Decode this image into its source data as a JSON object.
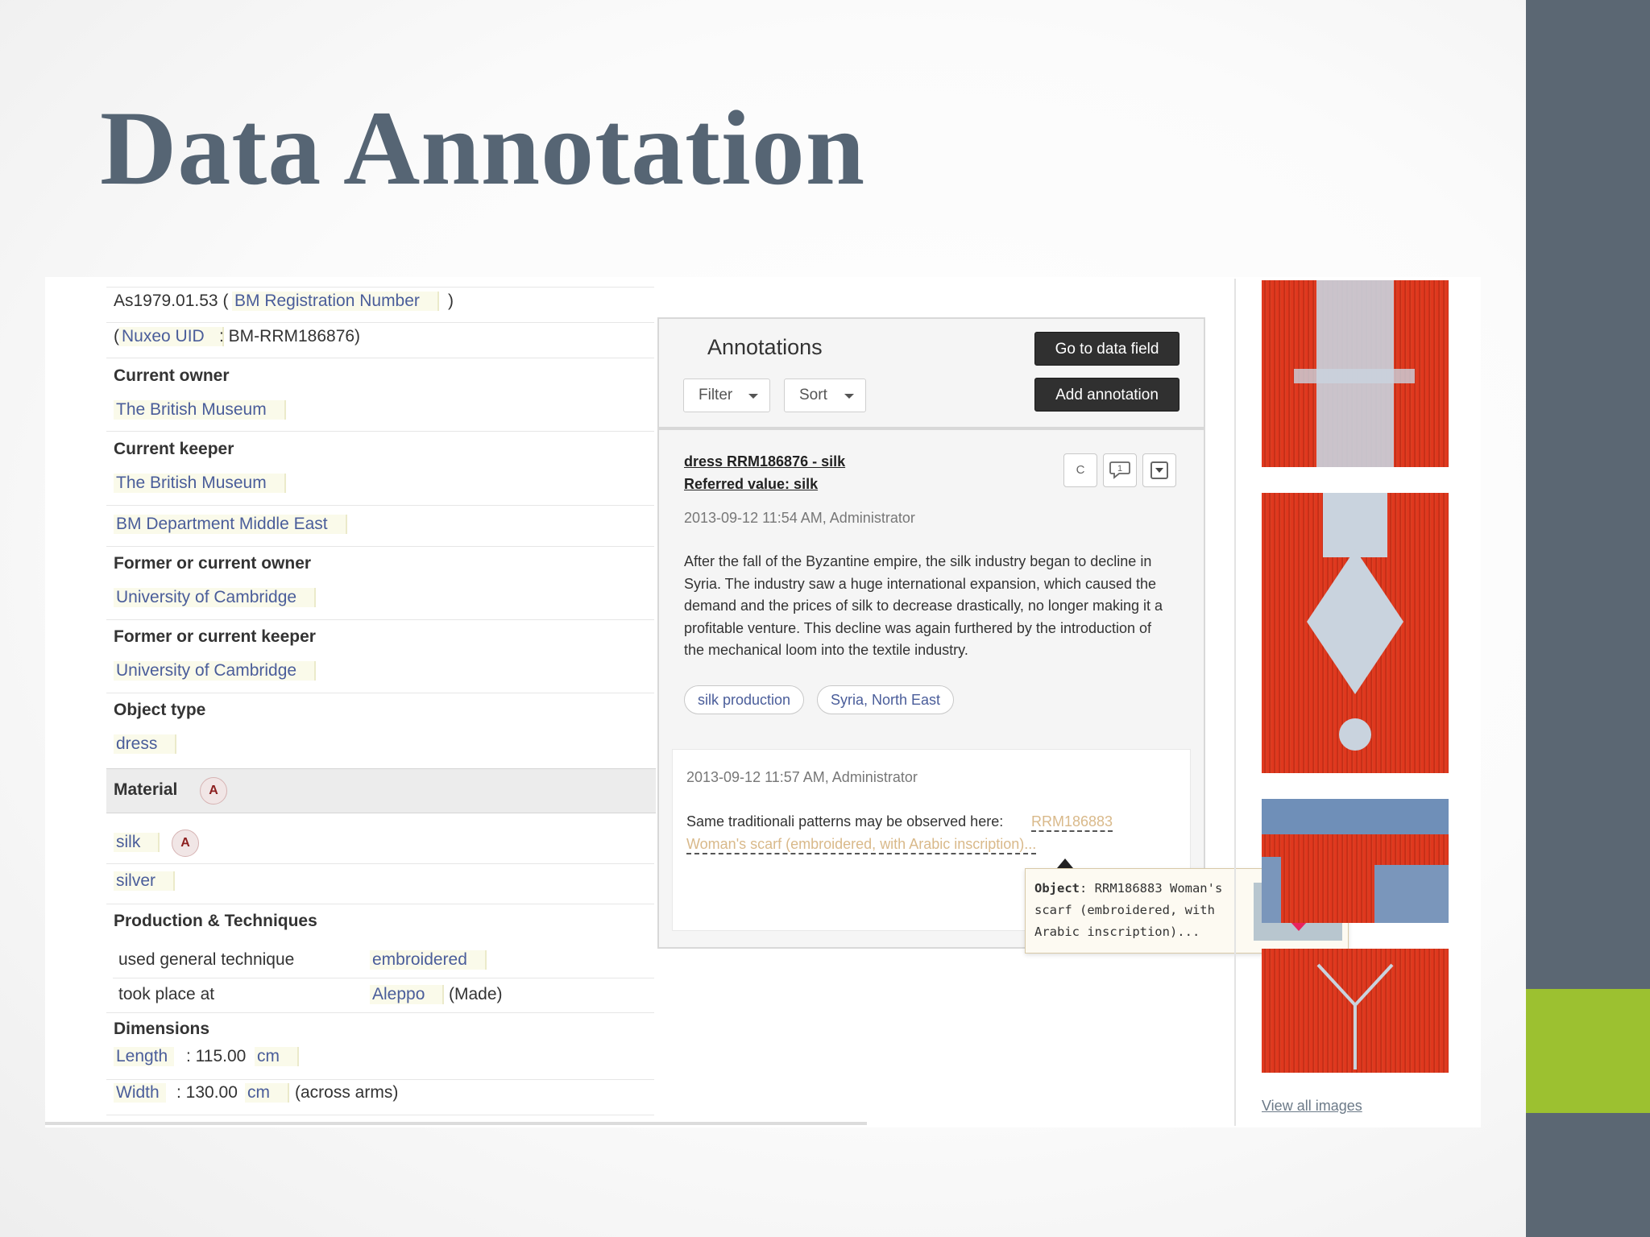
{
  "slide": {
    "title": "Data Annotation",
    "colors": {
      "title": "#566574",
      "sidebar": "#5b6773",
      "accent": "#9cc130"
    }
  },
  "record": {
    "reg_number_value": "As1979.01.53 (",
    "reg_number_label": "BM Registration Number",
    "reg_number_close": ")",
    "uid_open": "(",
    "uid_label": "Nuxeo UID",
    "uid_value": ": BM-RRM186876)",
    "current_owner_header": "Current owner",
    "current_owner": "The British Museum",
    "current_keeper_header": "Current keeper",
    "current_keeper": "The British Museum",
    "department": "BM Department Middle East",
    "former_owner_header": "Former or current owner",
    "former_owner": "University of Cambridge",
    "former_keeper_header": "Former or current keeper",
    "former_keeper": "University of Cambridge",
    "object_type_header": "Object type",
    "object_type": "dress",
    "material_header": "Material",
    "annotation_badge": "A",
    "materials": [
      "silk",
      "silver"
    ],
    "production_header": "Production & Techniques",
    "technique_label": "used general technique",
    "technique_value": "embroidered",
    "place_label": "took place at",
    "place_value": "Aleppo",
    "place_note": "(Made)",
    "dimensions_header": "Dimensions",
    "length_label": "Length",
    "length_value": ": 115.00",
    "length_unit": "cm",
    "width_label": "Width",
    "width_value": ": 130.00",
    "width_unit": "cm",
    "width_note": "(across arms)"
  },
  "annotations": {
    "title": "Annotations",
    "go_to_field_label": "Go to data field",
    "add_annotation_label": "Add annotation",
    "filter_label": "Filter",
    "sort_label": "Sort",
    "card1": {
      "heading": "dress RRM186876 - silk",
      "referred": "Referred value: silk",
      "meta": "2013-09-12 11:54 AM, Administrator",
      "body": "After the fall of the Byzantine empire, the silk industry began to decline in Syria. The industry saw a huge international expansion, which caused the demand and the prices of silk to decrease drastically, no longer making it a profitable venture. This decline was again furthered by the introduction of the mechanical loom into the textile industry.",
      "icon_c": "C",
      "icon_comment_count": "1",
      "tags": [
        "silk production",
        "Syria, North East"
      ]
    },
    "card2": {
      "meta": "2013-09-12 11:57 AM, Administrator",
      "body": "Same traditionali patterns may be observed here:",
      "link_line1": "RRM186883",
      "link_line2": "Woman's scarf (embroidered, with Arabic inscription)..."
    },
    "tooltip": {
      "label": "Object",
      "text": ": RRM186883 Woman's scarf (embroidered, with Arabic inscription)..."
    }
  },
  "images": {
    "view_all_label": "View all images"
  }
}
